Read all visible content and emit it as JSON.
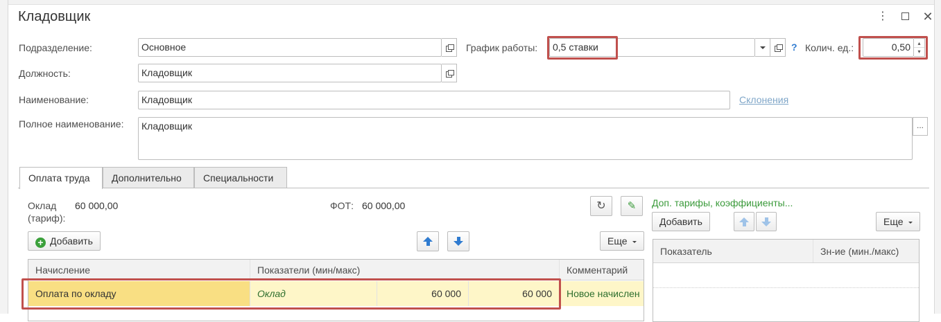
{
  "window": {
    "title": "Кладовщик",
    "menu_icon": "more-vertical-icon",
    "maximize_icon": "maximize-icon",
    "close_icon": "close-icon"
  },
  "form": {
    "subdivision_label": "Подразделение:",
    "subdivision_value": "Основное",
    "position_label": "Должность:",
    "position_value": "Кладовщик",
    "name_label": "Наименование:",
    "name_value": "Кладовщик",
    "declensions_link": "Склонения",
    "full_name_label": "Полное наименование:",
    "full_name_value": "Кладовщик",
    "full_name_more": "...",
    "schedule_label": "График работы:",
    "schedule_value": "0,5 ставки",
    "help": "?",
    "quantity_label": "Колич. ед.:",
    "quantity_value": "0,50"
  },
  "tabs": [
    {
      "label": "Оплата труда"
    },
    {
      "label": "Дополнительно"
    },
    {
      "label": "Специальности"
    }
  ],
  "pay": {
    "salary_label_line1": "Оклад",
    "salary_label_line2": "(тариф):",
    "salary_value": "60 000,00",
    "fot_label": "ФОТ:",
    "fot_value": "60 000,00",
    "add_label": "Добавить",
    "more_label": "Еще",
    "columns": [
      "Начисление",
      "Показатели (мин/макс)",
      "Комментарий"
    ],
    "rows": [
      {
        "accrual": "Оплата по окладу",
        "indicator": "Оклад",
        "min": "60 000",
        "max": "60 000",
        "comment": "Новое начислен"
      }
    ]
  },
  "extra": {
    "title": "Доп. тарифы, коэффициенты...",
    "add_label": "Добавить",
    "more_label": "Еще",
    "columns": [
      "Показатель",
      "Зн-ие (мин./макс)"
    ]
  },
  "colors": {
    "highlight": "#c0504d",
    "row_bg": "#fef6c8",
    "row_selected": "#f9df83",
    "link": "#7fa6c8",
    "green_title": "#3a9a3a"
  }
}
